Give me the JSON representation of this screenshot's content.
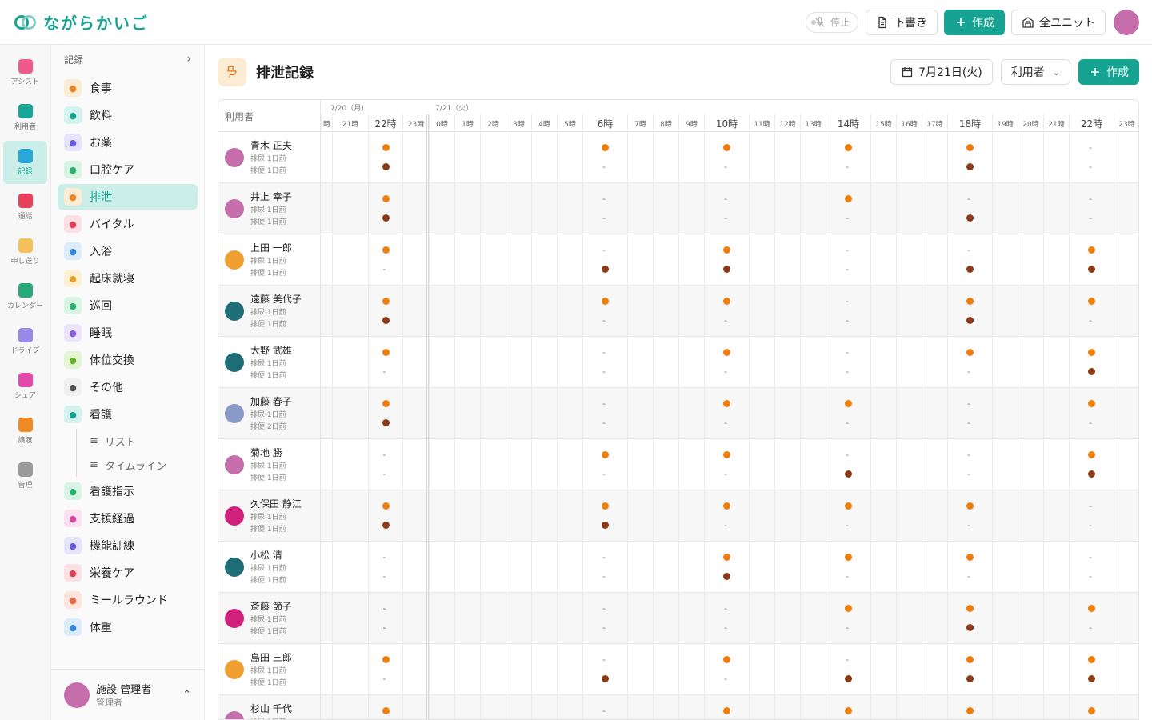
{
  "app": {
    "logo_text": "ながらかいご"
  },
  "topbar": {
    "stop_label": "停止",
    "draft_label": "下書き",
    "create_label": "作成",
    "unit_label": "全ユニット"
  },
  "rail": [
    {
      "label": "アシスト",
      "color": "#f05a8a"
    },
    {
      "label": "利用者",
      "color": "#18a596"
    },
    {
      "label": "記録",
      "color": "#2aa8d8",
      "active": true
    },
    {
      "label": "通話",
      "color": "#e8405a"
    },
    {
      "label": "申し送り",
      "color": "#f6c05a"
    },
    {
      "label": "カレンダー",
      "color": "#28a878"
    },
    {
      "label": "ドライブ",
      "color": "#9a8ae8"
    },
    {
      "label": "シェア",
      "color": "#e04aa8"
    },
    {
      "label": "譲渡",
      "color": "#f08a28"
    },
    {
      "label": "管理",
      "color": "#9a9a9a"
    }
  ],
  "subnav": {
    "header": "記録",
    "items": [
      {
        "label": "食事",
        "icon": "fork-knife-icon",
        "color": "#fdecd4",
        "fg": "#e8862a"
      },
      {
        "label": "飲料",
        "icon": "cup-icon",
        "color": "#d4f2ee",
        "fg": "#16a392"
      },
      {
        "label": "お薬",
        "icon": "pill-icon",
        "color": "#e6e4fb",
        "fg": "#6a5ae0"
      },
      {
        "label": "口腔ケア",
        "icon": "brush-icon",
        "color": "#d8f4e4",
        "fg": "#2ab070"
      },
      {
        "label": "排泄",
        "icon": "toilet-icon",
        "color": "#fdecd4",
        "fg": "#e8862a",
        "active": true
      },
      {
        "label": "バイタル",
        "icon": "heart-icon",
        "color": "#fde0e4",
        "fg": "#e0405a"
      },
      {
        "label": "入浴",
        "icon": "bath-icon",
        "color": "#dcecfb",
        "fg": "#3a88d8"
      },
      {
        "label": "起床就寝",
        "icon": "sunrise-icon",
        "color": "#fdf0d4",
        "fg": "#e8a22a"
      },
      {
        "label": "巡回",
        "icon": "shield-icon",
        "color": "#d8f4e4",
        "fg": "#2ab070"
      },
      {
        "label": "睡眠",
        "icon": "moon-icon",
        "color": "#ece4fb",
        "fg": "#8a5ae0"
      },
      {
        "label": "体位交換",
        "icon": "rotate-icon",
        "color": "#e4f4d4",
        "fg": "#6ab02a"
      },
      {
        "label": "その他",
        "icon": "more-icon",
        "color": "#f0f0f0",
        "fg": "#555"
      },
      {
        "label": "看護",
        "icon": "stethoscope-icon",
        "color": "#d4f2ee",
        "fg": "#16a392"
      }
    ],
    "subitems": [
      {
        "label": "リスト"
      },
      {
        "label": "タイムライン"
      }
    ],
    "items2": [
      {
        "label": "看護指示",
        "icon": "clipboard-icon",
        "color": "#d8f4e4",
        "fg": "#2ab070"
      },
      {
        "label": "支援経過",
        "icon": "note-icon",
        "color": "#fbe0f0",
        "fg": "#d04aa0"
      },
      {
        "label": "機能訓練",
        "icon": "footprint-icon",
        "color": "#e6e4fb",
        "fg": "#6a5ae0"
      },
      {
        "label": "栄養ケア",
        "icon": "apple-icon",
        "color": "#fde0e4",
        "fg": "#e0405a"
      },
      {
        "label": "ミールラウンド",
        "icon": "bowl-icon",
        "color": "#fde4dc",
        "fg": "#e86a4a"
      },
      {
        "label": "体重",
        "icon": "scale-icon",
        "color": "#dcecfb",
        "fg": "#3a88d8"
      }
    ]
  },
  "footer_user": {
    "name": "施設 管理者",
    "role": "管理者"
  },
  "page": {
    "title": "排泄記録",
    "date_label": "7月21日(火)",
    "filter_label": "利用者",
    "create_label": "作成"
  },
  "grid": {
    "name_header": "利用者",
    "day1": "7/20（月）",
    "day2": "7/21（火）",
    "hours_day1": [
      "時",
      "21時",
      "22時",
      "23時"
    ],
    "hours_day2": [
      "0時",
      "1時",
      "2時",
      "3時",
      "4時",
      "5時",
      "6時",
      "7時",
      "8時",
      "9時",
      "10時",
      "11時",
      "12時",
      "13時",
      "14時",
      "15時",
      "16時",
      "17時",
      "18時",
      "19時",
      "20時",
      "21時",
      "22時",
      "23時"
    ],
    "big_hours": [
      "22時",
      "6時",
      "10時",
      "14時",
      "18時",
      "22時"
    ],
    "cols": [
      "d22",
      "h6",
      "h10",
      "h14",
      "h18",
      "h22"
    ],
    "rows": [
      {
        "name": "青木 正夫",
        "urine": "排尿 1日前",
        "feces": "排便 1日前",
        "avatar": "#c66dab",
        "marks": [
          "uf",
          "u-",
          "u-",
          "u-",
          "uf",
          "--"
        ]
      },
      {
        "name": "井上 幸子",
        "urine": "排尿 1日前",
        "feces": "排便 1日前",
        "avatar": "#c66dab",
        "marks": [
          "uf",
          "--",
          "--",
          "u-",
          "-f",
          "--"
        ]
      },
      {
        "name": "上田 一郎",
        "urine": "排尿 1日前",
        "feces": "排便 1日前",
        "avatar": "#f0a030",
        "marks": [
          "u-",
          "-f",
          "uf",
          "--",
          "-f",
          "uf"
        ]
      },
      {
        "name": "遠藤 美代子",
        "urine": "排尿 1日前",
        "feces": "排便 1日前",
        "avatar": "#1f6e78",
        "marks": [
          "uf",
          "u-",
          "u-",
          "--",
          "uf",
          "u-"
        ]
      },
      {
        "name": "大野 武雄",
        "urine": "排尿 1日前",
        "feces": "排便 1日前",
        "avatar": "#1f6e78",
        "marks": [
          "u-",
          "--",
          "u-",
          "--",
          "u-",
          "uf"
        ]
      },
      {
        "name": "加藤 春子",
        "urine": "排尿 1日前",
        "feces": "排便 2日前",
        "avatar": "#8a9ac8",
        "marks": [
          "uf",
          "--",
          "u-",
          "u-",
          "--",
          "u-"
        ]
      },
      {
        "name": "菊地 勝",
        "urine": "排尿 1日前",
        "feces": "排便 1日前",
        "avatar": "#c66dab",
        "marks": [
          "--",
          "u-",
          "u-",
          "-f",
          "--",
          "uf"
        ]
      },
      {
        "name": "久保田 静江",
        "urine": "排尿 1日前",
        "feces": "排便 1日前",
        "avatar": "#d0207a",
        "marks": [
          "uf",
          "uf",
          "u-",
          "u-",
          "u-",
          "--"
        ]
      },
      {
        "name": "小松 清",
        "urine": "排尿 1日前",
        "feces": "排便 1日前",
        "avatar": "#1f6e78",
        "marks": [
          "--",
          "--",
          "uf",
          "u-",
          "u-",
          "--"
        ]
      },
      {
        "name": "斎藤 節子",
        "urine": "排尿 1日前",
        "feces": "排便 1日前",
        "avatar": "#d0207a",
        "marks": [
          "--",
          "--",
          "--",
          "u-",
          "uf",
          "u-"
        ]
      },
      {
        "name": "島田 三郎",
        "urine": "排尿 1日前",
        "feces": "排便 1日前",
        "avatar": "#f0a030",
        "marks": [
          "u-",
          "-f",
          "u-",
          "-f",
          "uf",
          "uf"
        ]
      },
      {
        "name": "杉山 千代",
        "urine": "排尿 1日前",
        "feces": "排便 1日前",
        "avatar": "#c66dab",
        "marks": [
          "u-",
          "--",
          "u-",
          "u-",
          "u-",
          "u-"
        ]
      }
    ]
  }
}
